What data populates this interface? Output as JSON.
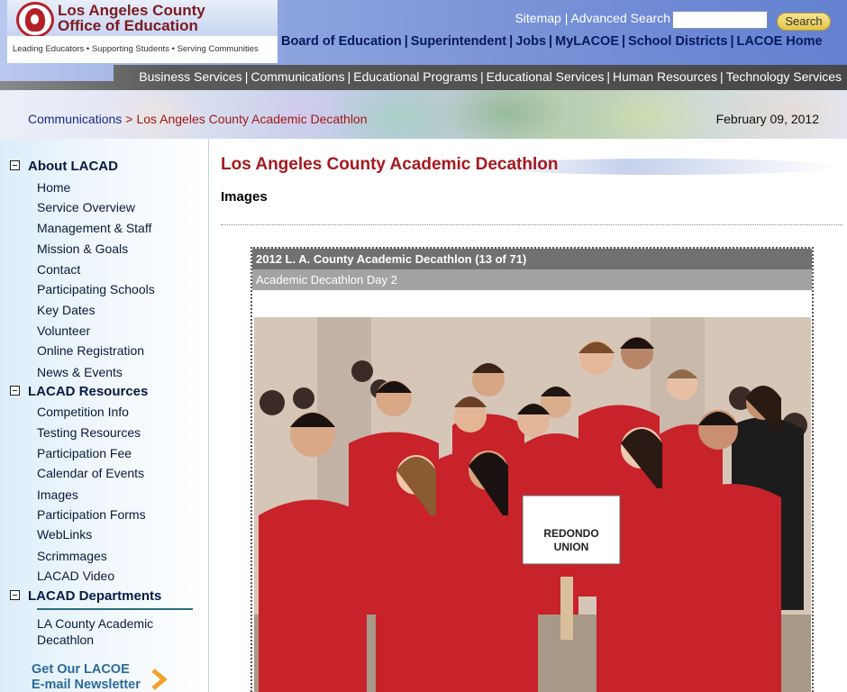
{
  "header": {
    "org_name_line1": "Los Angeles County",
    "org_name_line2": "Office of Education",
    "tagline": "Leading Educators • Supporting Students • Serving Communities",
    "sitemap": "Sitemap",
    "util_sep": "|",
    "advanced_search": "Advanced Search",
    "search_placeholder": "",
    "search_button": "Search"
  },
  "primary_nav": {
    "items": [
      "Board of Education",
      "Superintendent",
      "Jobs",
      "MyLACOE",
      "School Districts",
      "LACOE Home"
    ],
    "sep": "|"
  },
  "secondary_nav": {
    "items": [
      "Business Services",
      "Communications",
      "Educational Programs",
      "Educational Services",
      "Human Resources",
      "Technology Services"
    ],
    "sep": "|"
  },
  "breadcrumb": {
    "parent": "Communications",
    "sep": ">",
    "current": "Los Angeles County Academic Decathlon"
  },
  "date": "February 09, 2012",
  "sidebar": {
    "sections": [
      {
        "label": "About LACAD",
        "items": [
          "Home",
          "Service Overview",
          "Management & Staff",
          "Mission & Goals",
          "Contact",
          "Participating Schools",
          "Key Dates",
          "Volunteer",
          "Online Registration",
          "News & Events"
        ]
      },
      {
        "label": "LACAD Resources",
        "items": [
          "Competition Info",
          "Testing Resources",
          "Participation Fee",
          "Calendar of Events",
          "Images",
          "Participation Forms",
          "WebLinks",
          "Scrimmages",
          "LACAD Video"
        ]
      },
      {
        "label": "LACAD Departments",
        "items": [
          "LA County Academic Decathlon"
        ]
      }
    ],
    "newsletter_line1": "Get Our LACOE",
    "newsletter_line2": "E-mail Newsletter"
  },
  "main": {
    "page_title": "Los Angeles County Academic Decathlon",
    "section_title": "Images",
    "gallery": {
      "title": "2012 L. A. County Academic Decathlon (13 of 71)",
      "caption": "Academic Decathlon Day 2",
      "sign_line1": "REDONDO",
      "sign_line2": "UNION"
    }
  },
  "colors": {
    "brand_red": "#a5191e",
    "nav_navy": "#08185e",
    "shirt_red": "#c8222b"
  }
}
